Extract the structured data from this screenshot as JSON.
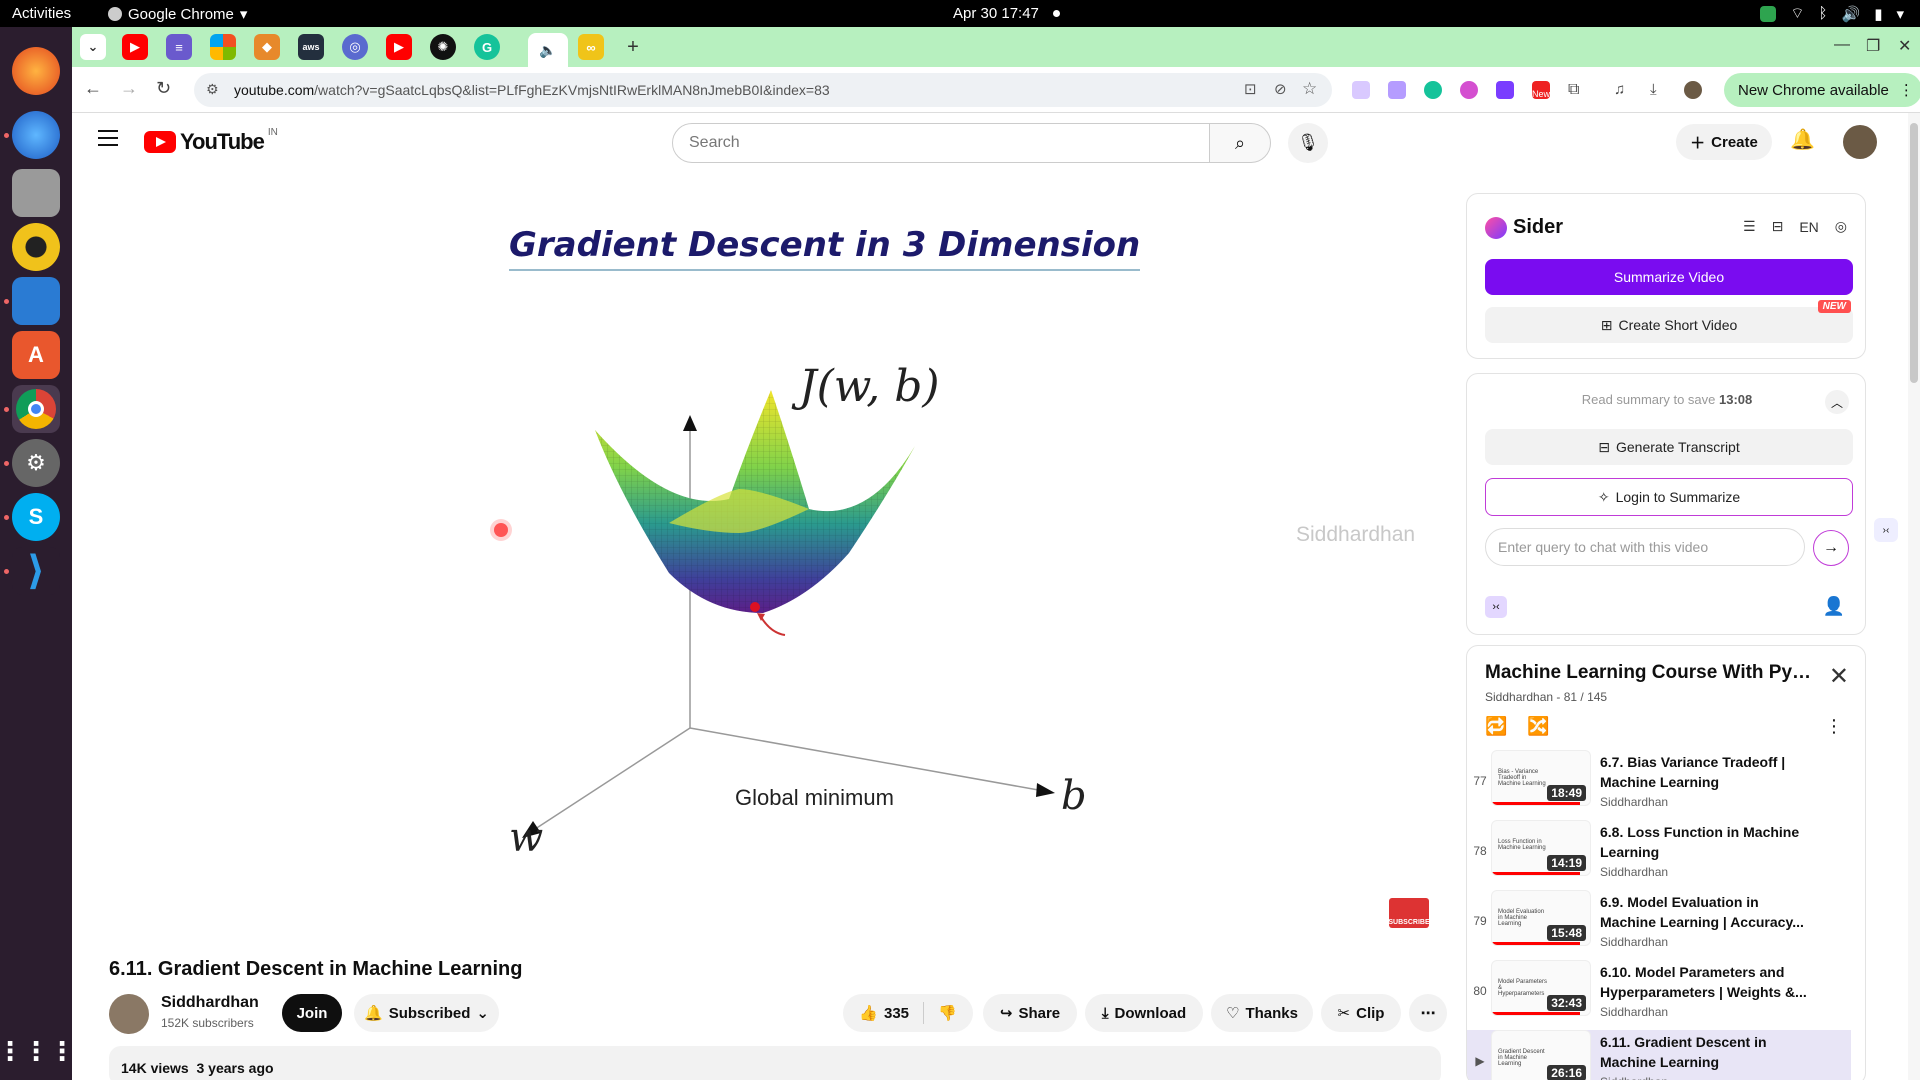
{
  "topbar": {
    "activities": "Activities",
    "app_name": "Google Chrome",
    "clock": "Apr 30  17:47"
  },
  "dock": {
    "items": [
      "firefox-icon",
      "thunderbird-icon",
      "files-icon",
      "rhythmbox-icon",
      "writer-icon",
      "appcenter-icon",
      "chrome-icon",
      "settings-icon",
      "skype-icon",
      "vscode-icon",
      "app-grid-icon"
    ]
  },
  "browser": {
    "url_domain": "youtube.com",
    "url_path": "/watch?v=gSaatcLqbsQ&list=PLfFghEzKVmjsNtIRwErklMAN8nJmebB0I&index=83",
    "new_chrome": "New Chrome available",
    "ext_new_badge": "New"
  },
  "youtube": {
    "logo": "YouTube",
    "region": "IN",
    "search_placeholder": "Search",
    "create_label": "Create"
  },
  "video": {
    "slide_title": "Gradient Descent in 3 Dimension",
    "func_label": "J(w, b)",
    "axis_w": "w",
    "axis_b": "b",
    "global_min": "Global minimum",
    "watermark": "Siddhardhan",
    "subscribe_badge": "SUBSCRIBE",
    "title": "6.11. Gradient Descent in Machine Learning"
  },
  "channel": {
    "name": "Siddhardhan",
    "subscribers": "152K subscribers",
    "join": "Join",
    "subscribed": "Subscribed"
  },
  "actions": {
    "likes": "335",
    "share": "Share",
    "download": "Download",
    "thanks": "Thanks",
    "clip": "Clip"
  },
  "description": {
    "views": "14K views",
    "age": "3 years ago"
  },
  "sider": {
    "brand": "Sider",
    "lang": "EN",
    "summarize": "Summarize Video",
    "short_video": "Create Short Video",
    "new_tag": "NEW",
    "read_summary_prefix": "Read summary to save",
    "read_summary_time": "13:08",
    "transcript": "Generate Transcript",
    "login": "Login to Summarize",
    "chat_placeholder": "Enter query to chat with this video"
  },
  "playlist": {
    "title": "Machine Learning Course With Pyth...",
    "subtitle": "Siddhardhan - 81 / 145",
    "items": [
      {
        "num": "77",
        "title": "6.7. Bias Variance Tradeoff | Machine Learning",
        "channel": "Siddhardhan",
        "duration": "18:49",
        "thumb": "Bias - Variance Tradeoff in Machine Learning",
        "watched": 0.9
      },
      {
        "num": "78",
        "title": "6.8. Loss Function in Machine Learning",
        "channel": "Siddhardhan",
        "duration": "14:19",
        "thumb": "Loss Function in Machine Learning",
        "watched": 0.9
      },
      {
        "num": "79",
        "title": "6.9. Model Evaluation in Machine Learning | Accuracy...",
        "channel": "Siddhardhan",
        "duration": "15:48",
        "thumb": "Model Evaluation in Machine Learning",
        "watched": 0.9
      },
      {
        "num": "80",
        "title": "6.10. Model Parameters and Hyperparameters | Weights &...",
        "channel": "Siddhardhan",
        "duration": "32:43",
        "thumb": "Model Parameters & Hyperparameters",
        "watched": 0.9
      },
      {
        "num": "▶",
        "title": "6.11. Gradient Descent in Machine Learning",
        "channel": "Siddhardhan",
        "duration": "26:16",
        "thumb": "Gradient Descent in Machine Learning",
        "watched": 0
      }
    ]
  },
  "colors": {
    "sider_purple": "#7a0cf0",
    "tabstrip": "#b7f0bf",
    "yt_red": "#ff0000"
  }
}
